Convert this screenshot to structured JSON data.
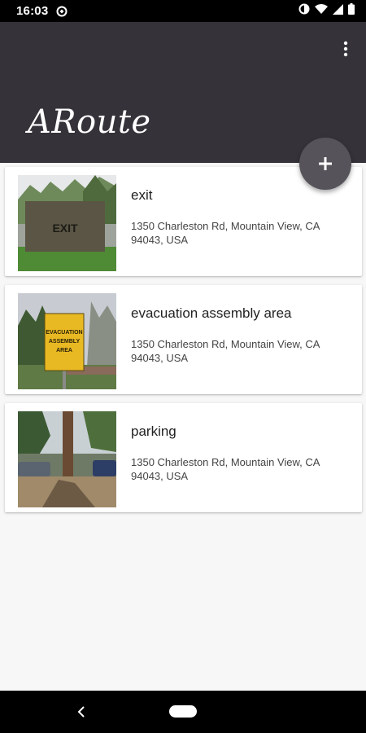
{
  "status_bar": {
    "time": "16:03",
    "icons": [
      "notification-icon",
      "data-saver-icon",
      "wifi-icon",
      "signal-icon",
      "battery-icon"
    ]
  },
  "app_bar": {
    "title": "ARoute",
    "menu_icon": "more-vert-icon"
  },
  "fab": {
    "icon": "plus-icon"
  },
  "routes": [
    {
      "name": "exit",
      "address": "1350 Charleston Rd, Mountain View, CA 94043, USA",
      "sign_text": "EXIT"
    },
    {
      "name": "evacuation assembly area",
      "address": "1350 Charleston Rd, Mountain View, CA 94043, USA",
      "sign_text": [
        "EVACUATION",
        "ASSEMBLY",
        "AREA"
      ]
    },
    {
      "name": "parking",
      "address": "1350 Charleston Rd, Mountain View, CA 94043, USA"
    }
  ],
  "colors": {
    "app_bar": "#353239",
    "fab": "#56535b",
    "background": "#f7f7f7"
  },
  "nav_bar": {
    "icons": [
      "back-icon",
      "home-pill-icon"
    ]
  }
}
